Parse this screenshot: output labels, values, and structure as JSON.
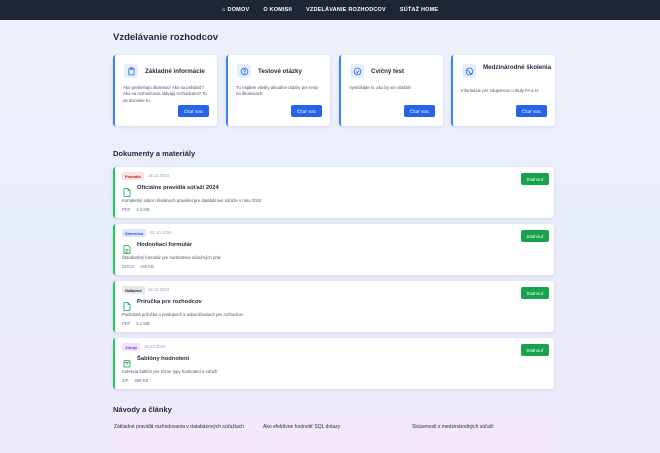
{
  "nav": {
    "items": [
      {
        "label": "DOMOV",
        "icon": "home-icon"
      },
      {
        "label": "O KOMISII"
      },
      {
        "label": "VZDELÁVANIE ROZHODCOV"
      },
      {
        "label": "SÚŤAŽ HOME"
      }
    ]
  },
  "main": {
    "title": "Vzdelávanie rozhodcov",
    "cards": [
      {
        "icon": "clipboard-icon",
        "title": "Základné informácie",
        "description": "Ako prebiehajú školenia? Ako sa prihlásiť? Ako sa rozhodcovia stávajú rozhodcami? To sa dozviete tu.",
        "button": "Čítať viac"
      },
      {
        "icon": "question-icon",
        "title": "Testové otázky",
        "description": "Tu nájdete všetky aktuálne otázky pre testy na školeniach.",
        "button": "Čítať viac"
      },
      {
        "icon": "check-circle-icon",
        "title": "Cvičný test",
        "description": "Vyskúšajte si, ako by ste obstáli!",
        "button": "Čítať viac"
      },
      {
        "icon": "globe-icon",
        "title": "Medzinárodné školenia",
        "description": "Informácie pre záujemcov o tituly FA a IA",
        "button": "Čítať viac"
      }
    ]
  },
  "documents": {
    "title": "Dokumenty a materiály",
    "items": [
      {
        "badge": "Pravidlá",
        "badge_bg": "#fde2e2",
        "badge_color": "#b91c1c",
        "date": "15.11.2024",
        "icon": "file-icon",
        "title": "Oficiálne pravidlá súťaží 2024",
        "description": "Kompletný súbor oficiálnych pravidiel pre databázové súťaže v roku 2024",
        "format": "PDF",
        "size": "2.4 MB",
        "button": "Stiahnuť"
      },
      {
        "badge": "Smernica",
        "badge_bg": "#dbe7fd",
        "badge_color": "#1d4ed8",
        "date": "01.10.2024",
        "icon": "form-icon",
        "title": "Hodnotiaci formulár",
        "description": "Štandardný formulár pre hodnotenie súťažných prác",
        "format": "DOCX",
        "size": "156 KB",
        "button": "Stiahnuť"
      },
      {
        "badge": "Odborné",
        "badge_bg": "#e5e7eb",
        "badge_color": "#111827",
        "date": "22.11.2024",
        "icon": "file-icon",
        "title": "Príručka pre rozhodcov",
        "description": "Podrobná príručka o postupoch a odporúčaniach pre rozhodcov",
        "format": "PDF",
        "size": "5.1 MB",
        "button": "Stiahnuť"
      },
      {
        "badge": "Zdroje",
        "badge_bg": "#ede4fb",
        "badge_color": "#7c3aed",
        "date": "18.12.2024",
        "icon": "archive-icon",
        "title": "Šablóny hodnotení",
        "description": "Kolekcia šablón pre rôzne typy hodnotení a súťaží",
        "format": "ZIP",
        "size": "890 KB",
        "button": "Stiahnuť"
      }
    ]
  },
  "guides": {
    "title": "Návody a články",
    "items": [
      {
        "title": "Základné pravidlá rozhodovania v databázových súťažiach"
      },
      {
        "title": "Ako efektívne hodnotiť SQL dotazy"
      },
      {
        "title": "Skúsenosti z medzinárodných súťaží"
      }
    ]
  },
  "colors": {
    "nav_bg": "#1e2534",
    "accent_blue": "#2563eb",
    "accent_green": "#16a34a"
  }
}
